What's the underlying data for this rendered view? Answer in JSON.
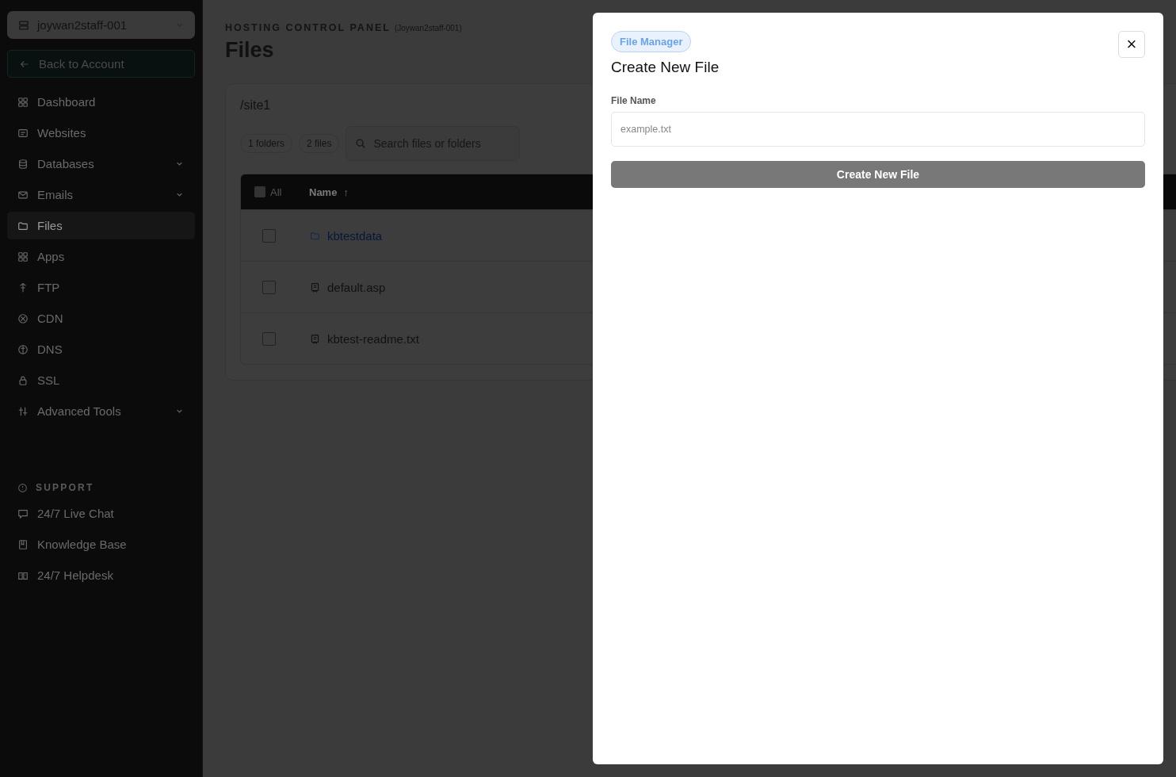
{
  "sidebar": {
    "account": "joywan2staff-001",
    "back_button": "Back to Account",
    "items": [
      {
        "label": "Dashboard",
        "expandable": false,
        "selected": false
      },
      {
        "label": "Websites",
        "expandable": false,
        "selected": false
      },
      {
        "label": "Databases",
        "expandable": true,
        "selected": false
      },
      {
        "label": "Emails",
        "expandable": true,
        "selected": false
      },
      {
        "label": "Files",
        "expandable": false,
        "selected": true
      },
      {
        "label": "Apps",
        "expandable": false,
        "selected": false
      },
      {
        "label": "FTP",
        "expandable": false,
        "selected": false
      },
      {
        "label": "CDN",
        "expandable": false,
        "selected": false
      },
      {
        "label": "DNS",
        "expandable": false,
        "selected": false
      },
      {
        "label": "SSL",
        "expandable": false,
        "selected": false
      },
      {
        "label": "Advanced Tools",
        "expandable": true,
        "selected": false
      }
    ],
    "support_heading": "SUPPORT",
    "support_items": [
      {
        "label": "24/7 Live Chat"
      },
      {
        "label": "Knowledge Base"
      },
      {
        "label": "24/7 Helpdesk"
      }
    ]
  },
  "header": {
    "eyebrow": "HOSTING CONTROL PANEL",
    "account": "(Joywan2staff-001)",
    "title": "Files"
  },
  "browser": {
    "path": "/site1",
    "counts": [
      "1 folders",
      "2 files"
    ],
    "search": {
      "placeholder": "Search files or folders"
    },
    "select_all": {
      "label": "All",
      "checked": false
    },
    "name_column": "Name",
    "sort_arrow": "↑",
    "rows": [
      {
        "name": "kbtestdata",
        "kind": "folder",
        "checked": false
      },
      {
        "name": "default.asp",
        "kind": "file",
        "checked": false
      },
      {
        "name": "kbtest-readme.txt",
        "kind": "file",
        "checked": false
      }
    ]
  },
  "modal": {
    "badge": "File Manager",
    "title": "Create New File",
    "field_label": "File Name",
    "field": {
      "placeholder": "example.txt"
    },
    "submit": "Create New File",
    "close": "×"
  }
}
